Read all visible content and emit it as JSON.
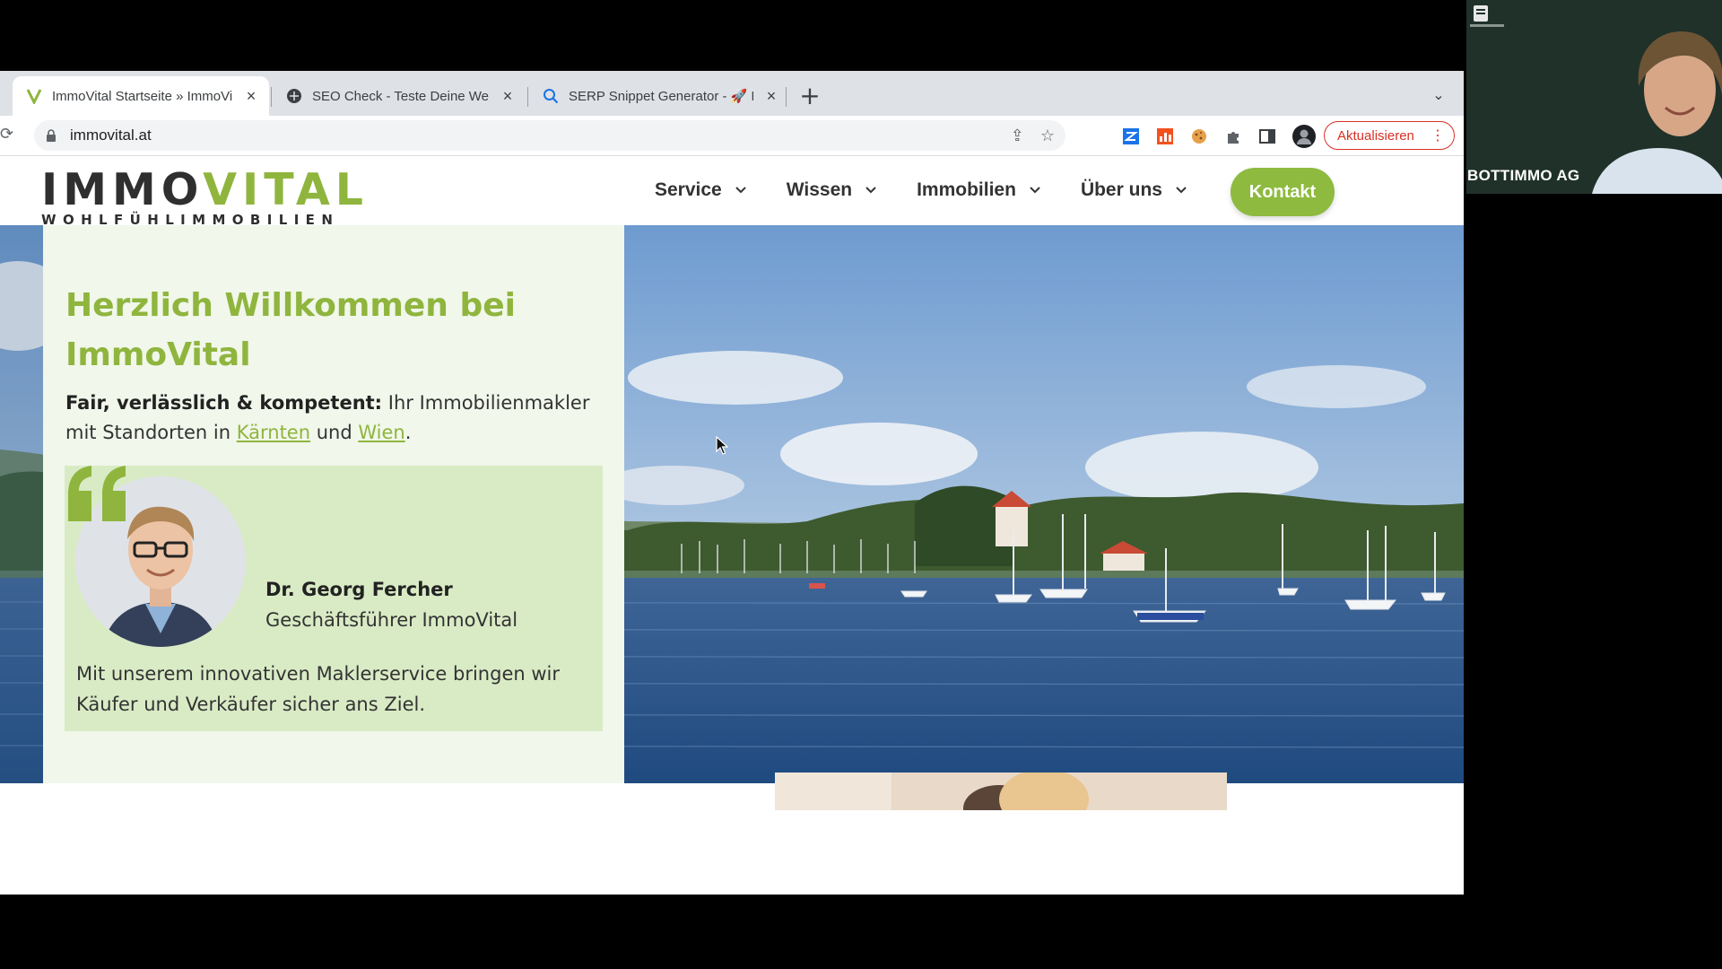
{
  "browser": {
    "tabs": [
      {
        "title": "ImmoVital Startseite » ImmoVi",
        "active": true
      },
      {
        "title": "SEO Check - Teste Deine Webs",
        "active": false
      },
      {
        "title": "SERP Snippet Generator - 🚀 F",
        "active": false
      }
    ],
    "new_tab": "+",
    "tab_menu": "⌄",
    "url": "immovital.at",
    "update_label": "Aktualisieren"
  },
  "site": {
    "logo": {
      "part1": "IMMO",
      "part2": "VITAL",
      "tagline": "WOHLFÜHLIMMOBILIEN"
    },
    "nav": [
      {
        "label": "Service"
      },
      {
        "label": "Wissen"
      },
      {
        "label": "Immobilien"
      },
      {
        "label": "Über uns"
      }
    ],
    "cta": "Kontakt",
    "hero": {
      "headline": "Herzlich Willkommen bei ImmoVital",
      "intro_bold": "Fair, verlässlich & kompetent:",
      "intro_text": " Ihr Immobilienmakler mit Standorten in ",
      "link1": "Kärnten",
      "intro_and": " und ",
      "link2": "Wien",
      "intro_end": ".",
      "quote_name": "Dr. Georg Fercher",
      "quote_role": "Geschäftsführer ImmoVital",
      "quote_text": "Mit unserem innovativen Maklerservice bringen wir Käufer und Verkäufer sicher ans Ziel."
    }
  },
  "video": {
    "participant": "BOTTIMMO AG"
  },
  "colors": {
    "brand_green": "#8fb53e",
    "cta_green": "#8dba3f",
    "update_red": "#d93025"
  }
}
